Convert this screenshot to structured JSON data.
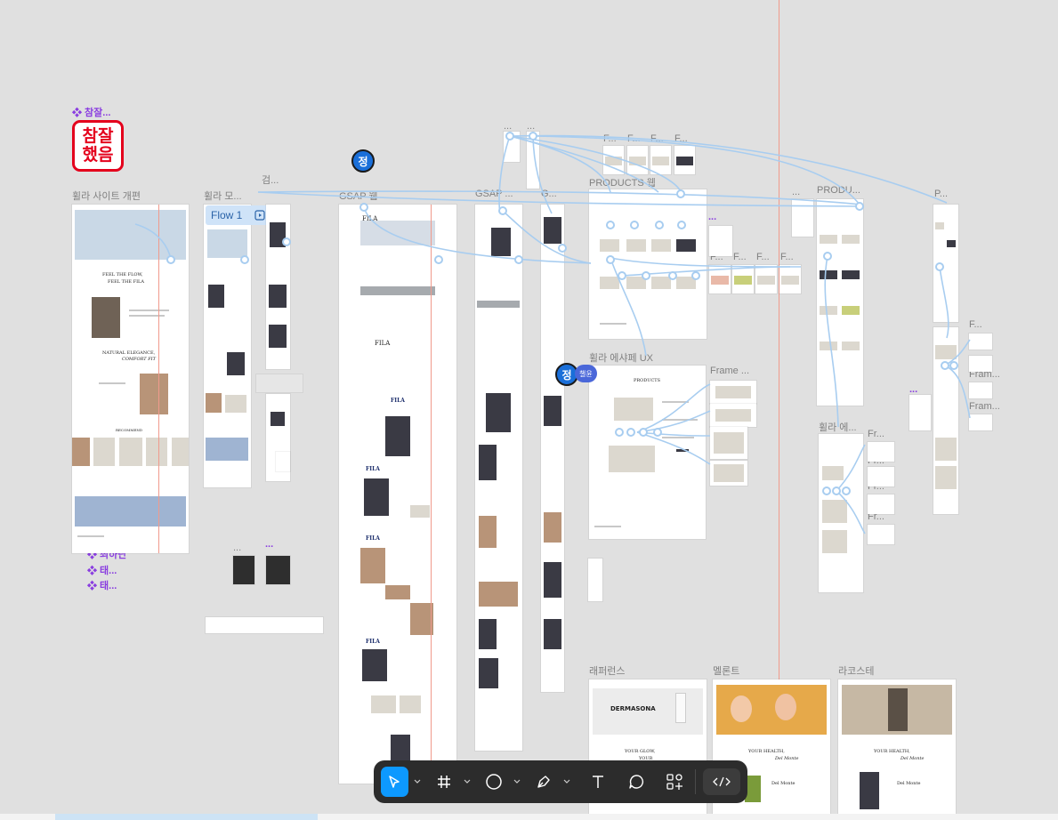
{
  "canvas": {
    "labels": {
      "chamjal": "❖ 참잘...",
      "site_renewal": "휠라 사이트 개편",
      "fila_mo": "휠라 모...",
      "search": "검...",
      "gsap": "GSAP 웹",
      "gsap2": "GSAP ...",
      "g": "G...",
      "products_web": "PRODUCTS 웹",
      "products_dots": "PRODU...",
      "p": "P...",
      "fila_eshape_ux": "휠라 에샤페 UX",
      "fila_e": "휠라 에...",
      "frame": "Frame ...",
      "fram": "Fram...",
      "fr": "Fr...",
      "f": "F...",
      "choehadan": "❖ 최하단",
      "tae": "❖ 태...",
      "lapelance": "래퍼런스",
      "melont": "멜론트",
      "lacoste": "라코스테",
      "dots": "..."
    },
    "stamp_lines": [
      "참잘",
      "했음"
    ],
    "cursor_pins": [
      "정",
      "정"
    ],
    "cursor_tag": "챌윤",
    "flow": {
      "label": "Flow 1"
    },
    "mockup_text": {
      "feel_the_flow": "FEEL THE FLOW,",
      "feel_the_fila": "FEEL THE FILA",
      "natural_elegance": "NATURAL ELEGANCE,",
      "comfort_fit": "COMFORT FIT",
      "recommend": "RECOMMEND",
      "fila": "FILA",
      "products": "PRODUCTS",
      "dermasona": "DERMASONA",
      "your_glow": "YOUR GLOW,",
      "your_health": "YOUR HEALTH,",
      "del_monte": "Del Monte",
      "your": "YOUR"
    }
  },
  "toolbar": {
    "tools": [
      {
        "name": "move-tool",
        "icon": "cursor-arrow-icon",
        "active": true
      },
      {
        "name": "frame-tool",
        "icon": "hash-frame-icon",
        "active": false
      },
      {
        "name": "shape-tool",
        "icon": "ellipse-icon",
        "active": false
      },
      {
        "name": "pen-tool",
        "icon": "pen-icon",
        "active": false
      },
      {
        "name": "text-tool",
        "icon": "text-icon",
        "active": false
      },
      {
        "name": "comment-tool",
        "icon": "comment-bubble-icon",
        "active": false
      },
      {
        "name": "actions-tool",
        "icon": "shapes-plus-icon",
        "active": false
      }
    ],
    "dev_mode": {
      "icon": "code-brackets-icon"
    },
    "accent": "#0d99ff"
  },
  "colors": {
    "canvas_bg": "#e0e0e0",
    "connector": "#a8cdf0",
    "guide_red": "#f09a8c",
    "component_purple": "#8a3ee0",
    "stamp_red": "#e4001c"
  }
}
